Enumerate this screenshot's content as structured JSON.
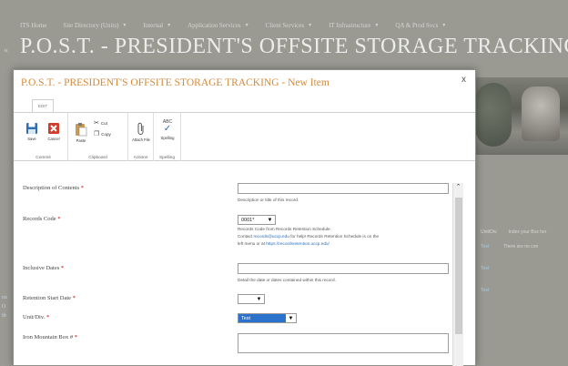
{
  "background": {
    "nav": [
      "ITS Home",
      "Site Directory (Units)",
      "Internal",
      "Application Services",
      "Client Services",
      "IT Infrastructure",
      "QA & Prod Svcs"
    ],
    "site_title": "P.O.S.T. - PRESIDENT'S OFFSITE STORAGE TRACKING",
    "list_headers": [
      "Unit/Div.",
      "Index your Box her"
    ],
    "list_rows": [
      "Test",
      "Test",
      "Test"
    ],
    "empty_message": "There are no con",
    "left_stubs": [
      "ox",
      "O",
      "ib"
    ]
  },
  "modal": {
    "title": "P.O.S.T. - PRESIDENT'S OFFSITE STORAGE TRACKING - New Item",
    "close": "x",
    "ribbon_tab": "EDIT",
    "ribbon": {
      "commit": {
        "label": "Commit",
        "save": "Save",
        "cancel": "Cancel"
      },
      "clipboard": {
        "label": "Clipboard",
        "paste": "Paste",
        "cut": "Cut",
        "copy": "Copy"
      },
      "actions": {
        "label": "Actions",
        "attach": "Attach File"
      },
      "spelling": {
        "label": "Spelling",
        "spelling": "Spelling",
        "abc": "ABC"
      }
    },
    "form": {
      "description": {
        "label": "Description of Contents",
        "req": "*",
        "help": "Description or title of this record."
      },
      "records_code": {
        "label": "Records Code",
        "req": "*",
        "value": "0001*",
        "help1": "Records Code  from Records Retention Schedule.",
        "help2_pre": "Contact ",
        "help2_link": "records@uccp.edu",
        "help2_post": " for help! Records Retention Schedule is on the",
        "help3_pre": "left menu or at ",
        "help3_link": "https://recordsretention.uccp.edu/"
      },
      "inclusive_dates": {
        "label": "Inclusive Dates",
        "req": "*",
        "help": "Detail the date or dates contained within this record."
      },
      "retention_start": {
        "label": "Retention Start Date",
        "req": "*",
        "value": ""
      },
      "unit_div": {
        "label": "Unit/Div.",
        "req": "*",
        "value": "Test"
      },
      "iron_mountain": {
        "label": "Iron Mountain Box #",
        "req": "*"
      }
    }
  }
}
